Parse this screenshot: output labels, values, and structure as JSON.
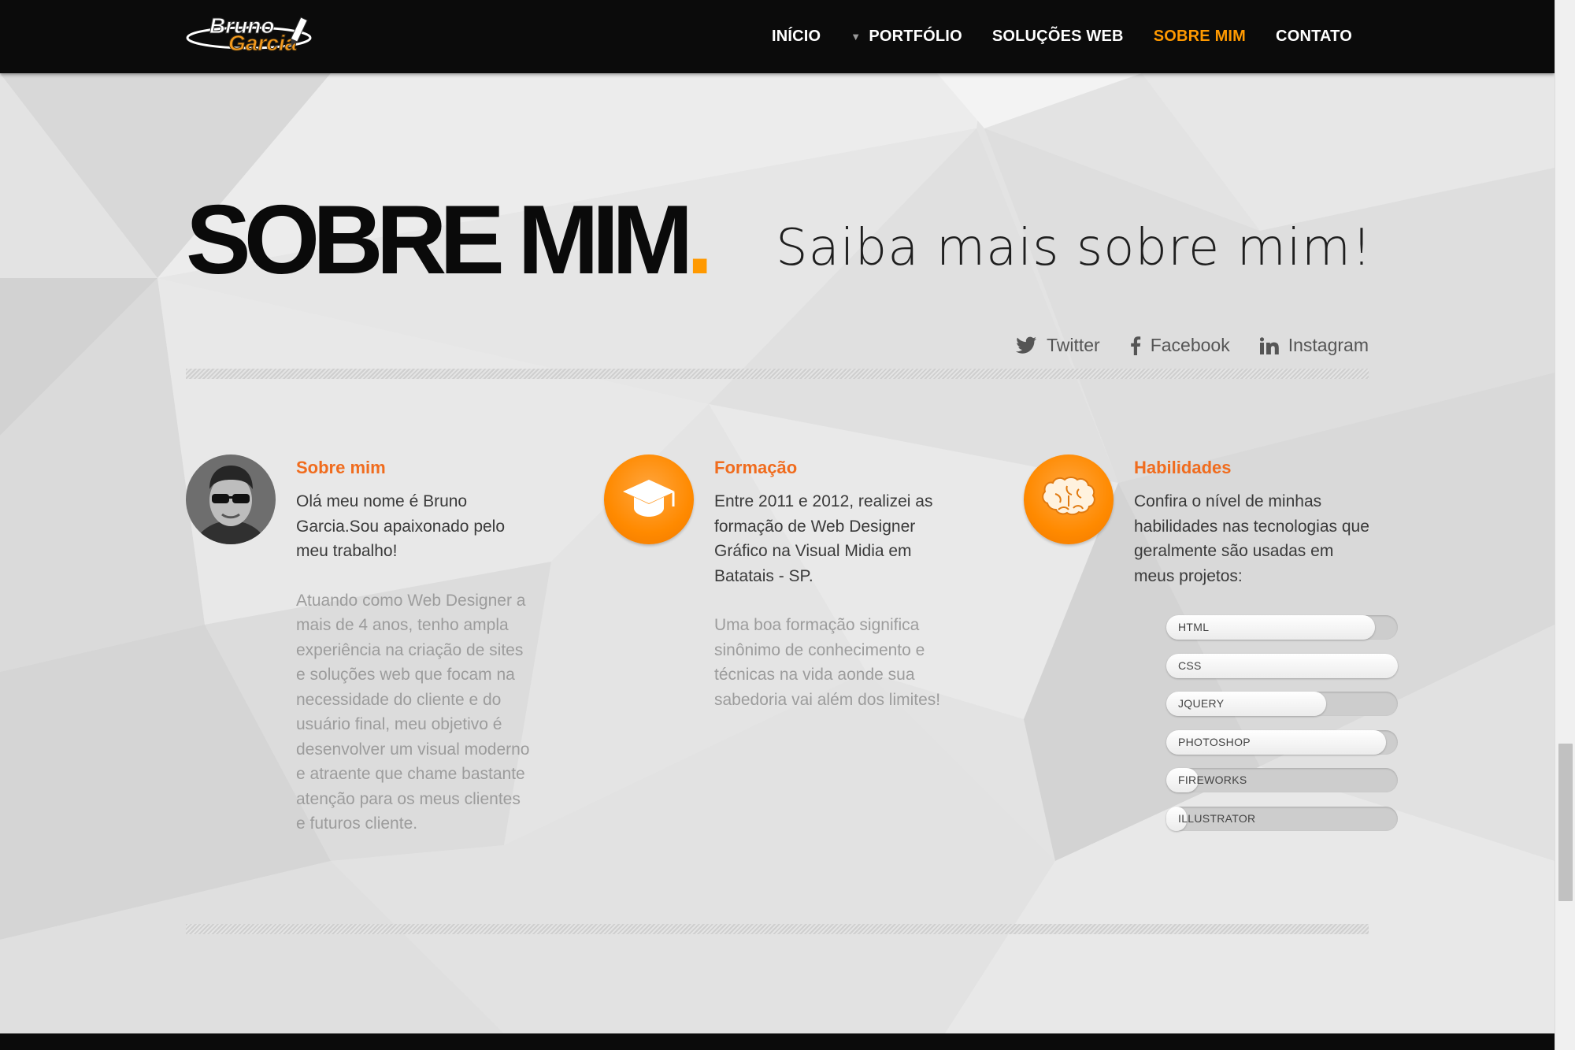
{
  "nav": {
    "brand_line1": "Bruno",
    "brand_line2": "Garcia",
    "items": [
      {
        "label": "INÍCIO"
      },
      {
        "label": "PORTFÓLIO",
        "has_dropdown": true
      },
      {
        "label": "SOLUÇÕES WEB"
      },
      {
        "label": "SOBRE MIM",
        "active": true
      },
      {
        "label": "CONTATO"
      }
    ]
  },
  "hero": {
    "title": "SOBRE MIM",
    "title_dot": ".",
    "subtitle": "Saiba mais sobre mim!"
  },
  "social": [
    {
      "label": "Twitter",
      "icon": "twitter-icon"
    },
    {
      "label": "Facebook",
      "icon": "facebook-icon"
    },
    {
      "label": "Instagram",
      "icon": "linkedin-icon"
    }
  ],
  "columns": {
    "about": {
      "title": "Sobre mim",
      "p1": "Olá meu nome é Bruno Garcia.Sou apaixonado pelo meu trabalho!",
      "p2": "Atuando como Web Designer a mais de 4 anos, tenho ampla experiência na criação de sites e soluções web que focam na necessidade do cliente e do usuário final, meu objetivo é desenvolver um visual moderno e atraente que chame bastante atenção para os meus clientes e futuros cliente."
    },
    "education": {
      "title": "Formação",
      "p1": "Entre 2011 e 2012, realizei as formação de Web Designer Gráfico na Visual Midia em Batatais - SP.",
      "p2": "Uma boa formação significa sinônimo de conhecimento e técnicas na vida aonde sua sabedoria vai além dos limites!"
    },
    "skills": {
      "title": "Habilidades",
      "p1": "Confira o nível de minhas habilidades nas tecnologias que geralmente são usadas em meus projetos:",
      "items": [
        {
          "label": "HTML",
          "level": 0.9
        },
        {
          "label": "CSS",
          "level": 1.0
        },
        {
          "label": "JQUERY",
          "level": 0.69
        },
        {
          "label": "PHOTOSHOP",
          "level": 0.95
        },
        {
          "label": "FIREWORKS",
          "level": 0.14
        },
        {
          "label": "ILLUSTRATOR",
          "level": 0.09
        }
      ]
    }
  },
  "colors": {
    "accent": "#ff9900",
    "heading_orange": "#f06c1e",
    "nav_bg": "#0b0b0b"
  }
}
